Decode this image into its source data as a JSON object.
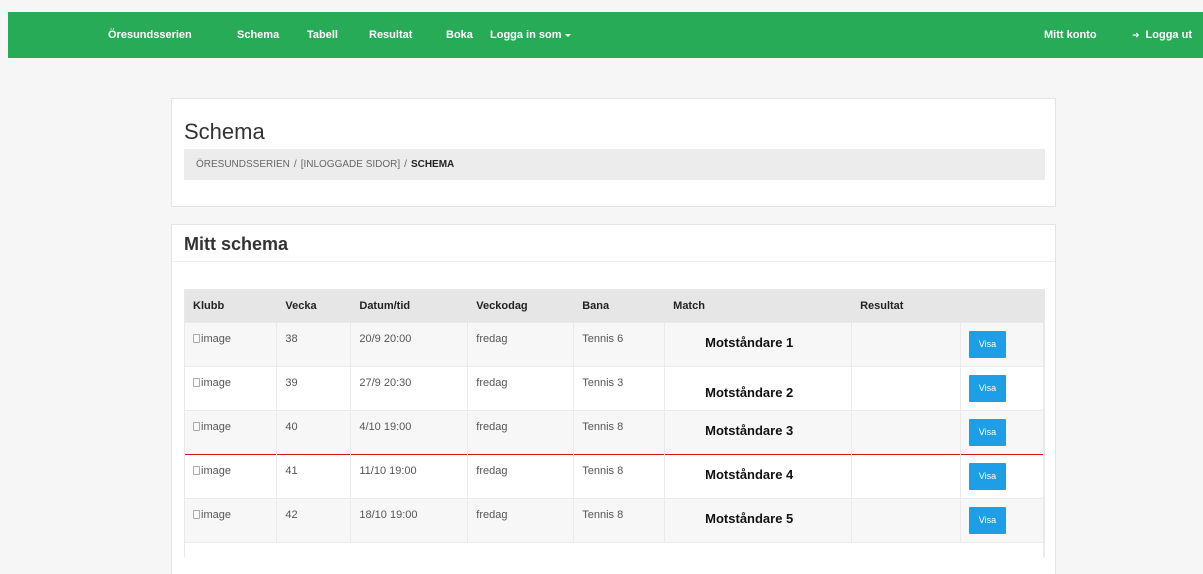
{
  "nav": {
    "brand": "Öresundsserien",
    "items": [
      "Schema",
      "Tabell",
      "Resultat",
      "Boka"
    ],
    "login_dropdown": "Logga in som",
    "account": "Mitt konto",
    "logout": "Logga ut"
  },
  "page": {
    "title": "Schema",
    "breadcrumb": [
      "ÖRESUNDSSERIEN",
      "[INLOGGADE SIDOR]",
      "SCHEMA"
    ],
    "separator": "/"
  },
  "schedule": {
    "title": "Mitt schema",
    "columns": [
      "Klubb",
      "Vecka",
      "Datum/tid",
      "Veckodag",
      "Bana",
      "Match",
      "Resultat",
      ""
    ],
    "rows": [
      {
        "klubb": "image",
        "vecka": "38",
        "datum": "20/9 20:00",
        "veckodag": "fredag",
        "bana": "Tennis 6",
        "match": "Motståndare 1",
        "resultat": "",
        "action": "Visa"
      },
      {
        "klubb": "image",
        "vecka": "39",
        "datum": "27/9 20:30",
        "veckodag": "fredag",
        "bana": "Tennis 3",
        "match": "Motståndare 2",
        "resultat": "",
        "action": "Visa"
      },
      {
        "klubb": "image",
        "vecka": "40",
        "datum": "4/10 19:00",
        "veckodag": "fredag",
        "bana": "Tennis 8",
        "match": "Motståndare 3",
        "resultat": "",
        "action": "Visa"
      },
      {
        "klubb": "image",
        "vecka": "41",
        "datum": "11/10 19:00",
        "veckodag": "fredag",
        "bana": "Tennis 8",
        "match": "Motståndare 4",
        "resultat": "",
        "action": "Visa"
      },
      {
        "klubb": "image",
        "vecka": "42",
        "datum": "18/10 19:00",
        "veckodag": "fredag",
        "bana": "Tennis 8",
        "match": "Motståndare 5",
        "resultat": "",
        "action": "Visa"
      }
    ]
  },
  "colors": {
    "nav_bg": "#28ab56",
    "button_bg": "#1e9ee6",
    "marker_line": "#d0161c"
  }
}
